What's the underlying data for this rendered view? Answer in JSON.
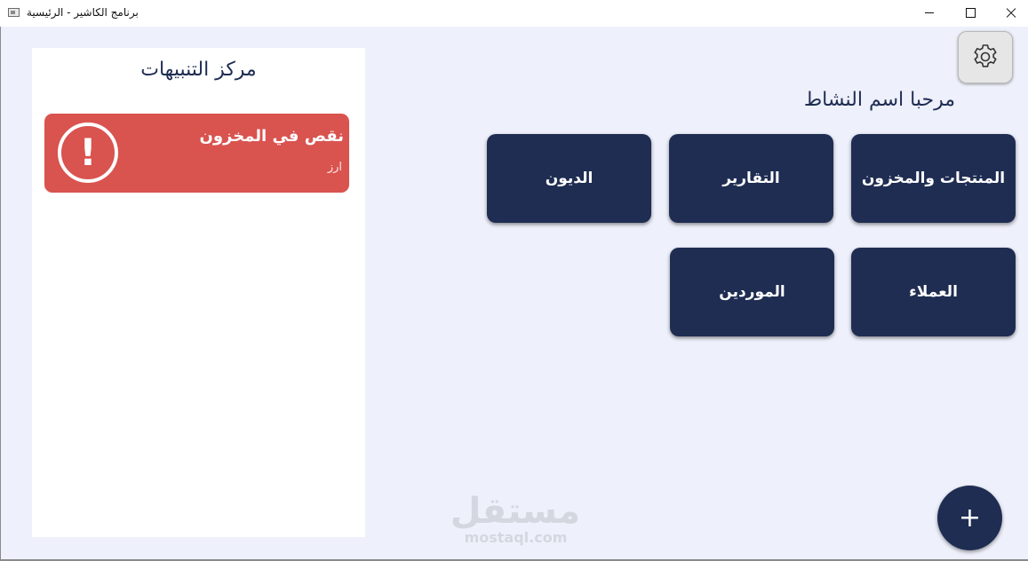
{
  "window": {
    "title": "برنامج الكاشير - الرئيسية"
  },
  "notifications": {
    "title": "مركز التنبيهات",
    "items": [
      {
        "icon": "exclamation-icon",
        "title": "نقص في المخزون",
        "detail": "ارز",
        "color": "#d9534f"
      }
    ]
  },
  "header": {
    "welcome": "مرحبا اسم النشاط",
    "settings_icon": "gear-icon"
  },
  "tiles": [
    {
      "label": "المنتجات والمخزون"
    },
    {
      "label": "التقارير"
    },
    {
      "label": "الديون"
    },
    {
      "label": "العملاء"
    },
    {
      "label": "الموردين"
    }
  ],
  "watermark": {
    "arabic": "مستقل",
    "latin": "mostaql.com"
  },
  "fab": {
    "icon": "plus-icon",
    "symbol": "+"
  },
  "colors": {
    "primary": "#1f2d52",
    "alert": "#d9534f",
    "background": "#eef0fb"
  }
}
